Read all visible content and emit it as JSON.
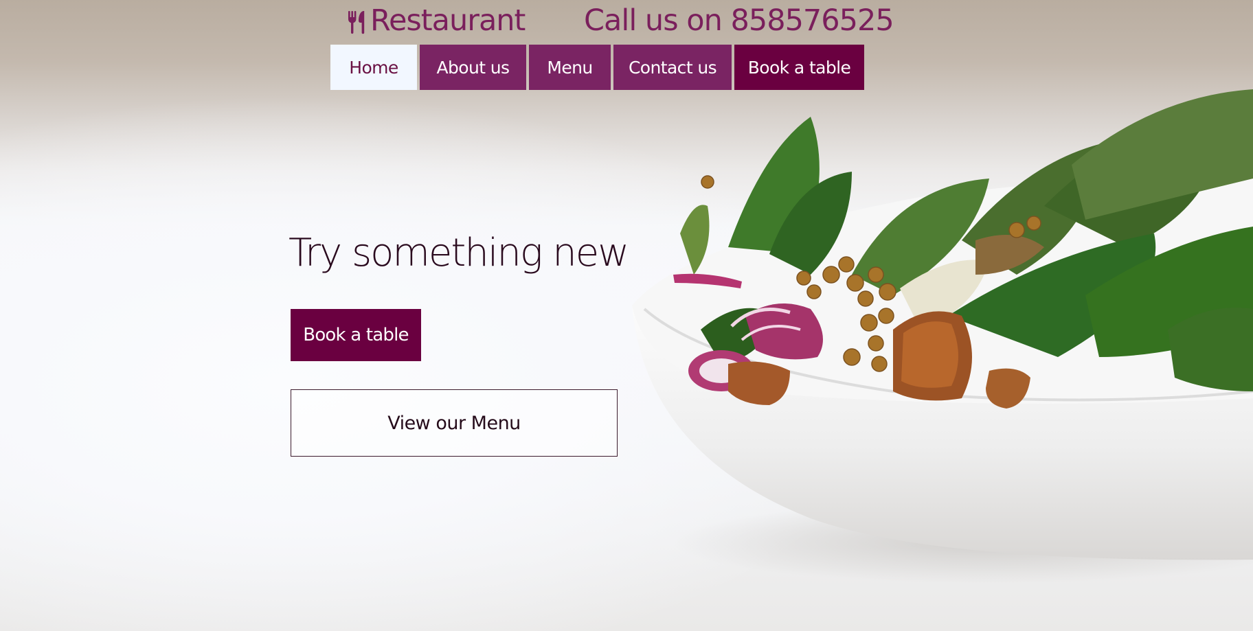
{
  "header": {
    "brand_icon": "fork-knife-icon",
    "brand_name": "Restaurant",
    "phone_text": "Call us on 858576525"
  },
  "nav": {
    "items": [
      {
        "label": "Home",
        "active": true
      },
      {
        "label": "About us"
      },
      {
        "label": "Menu"
      },
      {
        "label": "Contact us"
      },
      {
        "label": "Book a table"
      }
    ]
  },
  "hero": {
    "title": "Try something new",
    "book_button": "Book a table",
    "menu_button": "View our Menu",
    "image": "salad-bowl-photo"
  },
  "colors": {
    "brand_purple": "#7a1f5c",
    "nav_bg": "#7a2463",
    "cta_bg": "#6a0040",
    "active_bg": "#f2f7ff",
    "title_text": "#2a0a1e"
  }
}
